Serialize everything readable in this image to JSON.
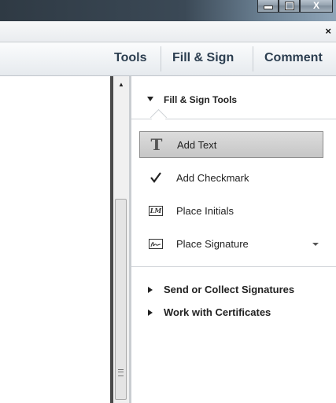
{
  "window": {
    "buttons": {
      "minimize": "minimize",
      "maximize": "maximize",
      "close": "X"
    },
    "doc_close": "×"
  },
  "tabs": [
    {
      "label": "Tools"
    },
    {
      "label": "Fill & Sign"
    },
    {
      "label": "Comment"
    }
  ],
  "pane": {
    "section_title": "Fill & Sign Tools",
    "section_expanded": true,
    "tools": [
      {
        "label": "Add Text",
        "icon": "text-t-icon",
        "selected": true
      },
      {
        "label": "Add Checkmark",
        "icon": "checkmark-icon"
      },
      {
        "label": "Place Initials",
        "icon": "initials-icon",
        "icon_text": "LM"
      },
      {
        "label": "Place Signature",
        "icon": "signature-icon",
        "has_dropdown": true
      }
    ],
    "collapsed_sections": [
      {
        "label": "Send or Collect Signatures"
      },
      {
        "label": "Work with Certificates"
      }
    ]
  }
}
